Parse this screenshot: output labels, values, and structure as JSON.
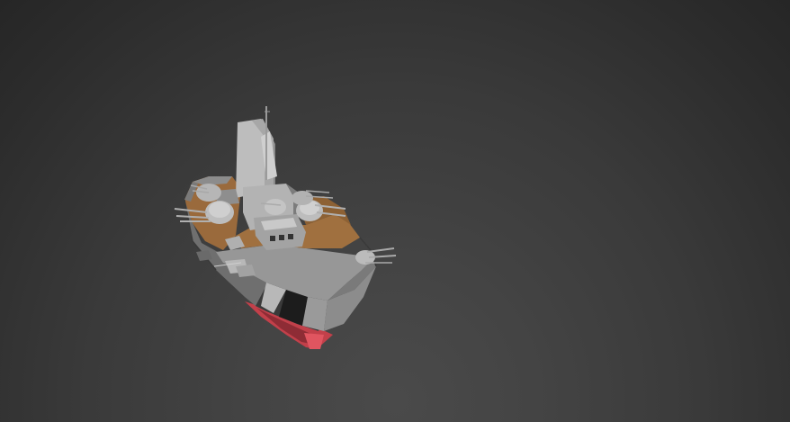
{
  "viewport": {
    "background": "#2e2e2e",
    "object": "battleship-model"
  },
  "colors": {
    "hull": "#8f8f8f",
    "hull_dark": "#5c5c5c",
    "hull_light": "#b5b5b5",
    "deck_wood": "#9a6a3c",
    "superstructure": "#a6a6a6",
    "turret": "#bdbdbd",
    "waterline": "#c2404a",
    "shadow": "#1a1a1a"
  }
}
